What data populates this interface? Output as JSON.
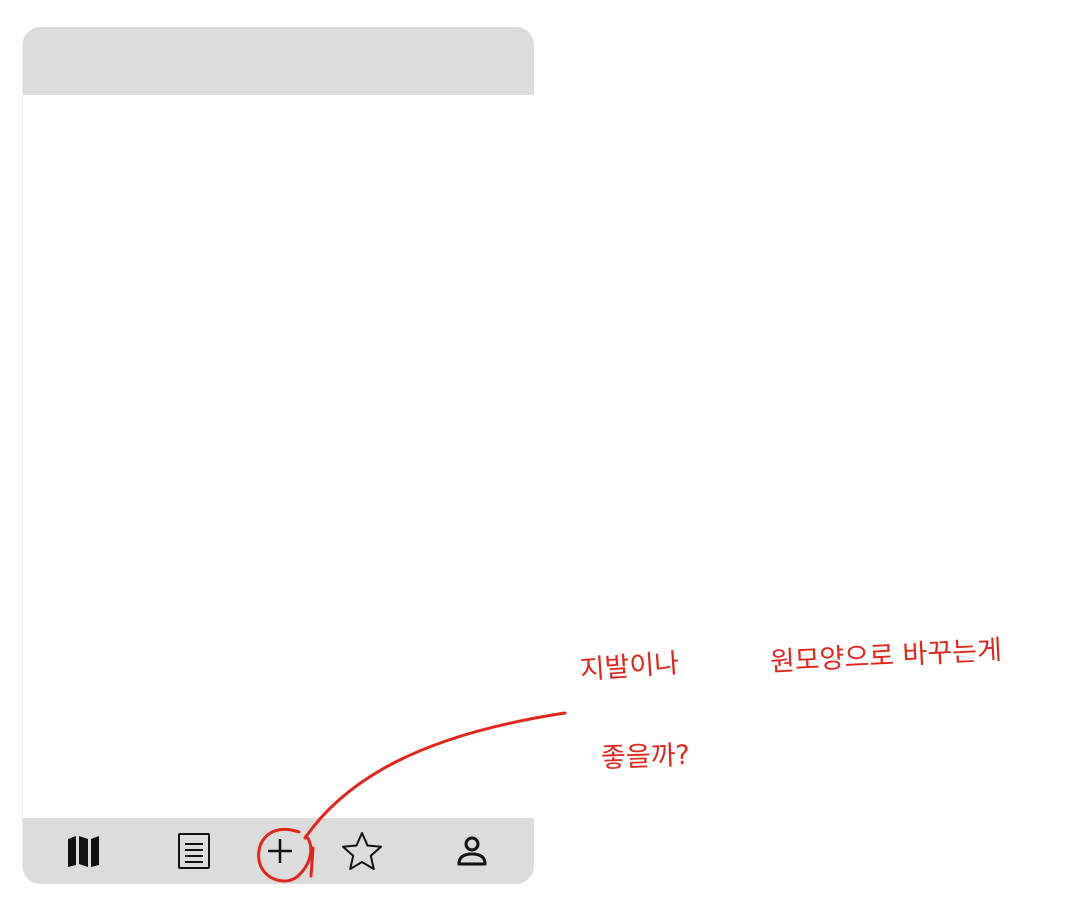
{
  "nav": {
    "items": [
      {
        "name": "map",
        "icon": "map-icon"
      },
      {
        "name": "list",
        "icon": "list-icon"
      },
      {
        "name": "add",
        "icon": "plus-icon"
      },
      {
        "name": "favorites",
        "icon": "star-icon"
      },
      {
        "name": "profile",
        "icon": "person-icon"
      }
    ]
  },
  "annotation": {
    "line1_a": "지발이나",
    "line1_b": "원모양으로 바꾸는게",
    "line2": "좋을까?",
    "color": "#e3261c"
  },
  "colors": {
    "bar_background": "#dcdcdc",
    "icon": "#111111",
    "annotation": "#e3261c"
  }
}
